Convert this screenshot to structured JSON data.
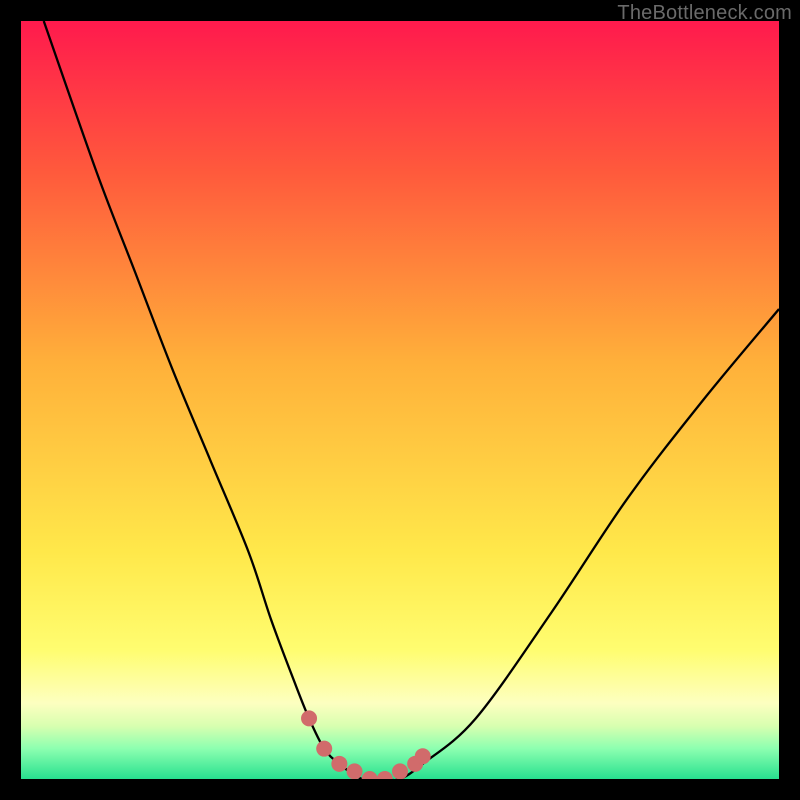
{
  "watermark": "TheBottleneck.com",
  "chart_data": {
    "type": "line",
    "xlim": [
      0,
      100
    ],
    "ylim": [
      0,
      100
    ],
    "xlabel": "",
    "ylabel": "",
    "title": "",
    "grid": false,
    "series": [
      {
        "name": "bottleneck-curve",
        "color": "#000000",
        "x": [
          3,
          10,
          15,
          20,
          25,
          30,
          33,
          36,
          38,
          40,
          42,
          45,
          48,
          50,
          53,
          60,
          70,
          80,
          90,
          100
        ],
        "values": [
          100,
          80,
          67,
          54,
          42,
          30,
          21,
          13,
          8,
          4,
          2,
          0,
          0,
          0,
          2,
          8,
          22,
          37,
          50,
          62
        ]
      }
    ],
    "trough_markers": {
      "name": "trough-dots",
      "color": "#d16b6b",
      "x": [
        38,
        40,
        42,
        44,
        46,
        48,
        50,
        52,
        53
      ],
      "values": [
        8,
        4,
        2,
        1,
        0,
        0,
        1,
        2,
        3
      ]
    },
    "background": {
      "type": "vertical-gradient",
      "stops": [
        {
          "pos": 0,
          "color": "#ff1a4d"
        },
        {
          "pos": 20,
          "color": "#ff5a3c"
        },
        {
          "pos": 45,
          "color": "#ffb03a"
        },
        {
          "pos": 70,
          "color": "#ffe84a"
        },
        {
          "pos": 83,
          "color": "#fffd70"
        },
        {
          "pos": 90,
          "color": "#fdffc0"
        },
        {
          "pos": 93,
          "color": "#d8ffb0"
        },
        {
          "pos": 96,
          "color": "#8cffb0"
        },
        {
          "pos": 100,
          "color": "#27e08f"
        }
      ]
    }
  }
}
